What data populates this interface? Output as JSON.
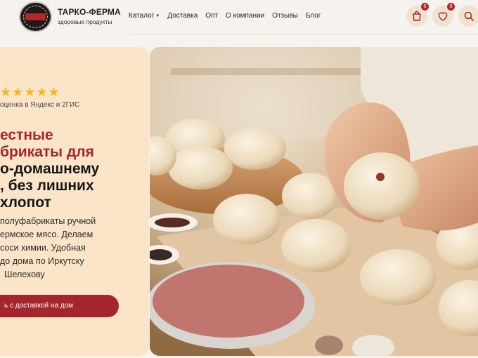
{
  "header": {
    "brand_name": "ТАРКО-ФЕРМА",
    "brand_tagline": "здоровые продукты",
    "logo_text": "ТАРКО ФЕРМА",
    "nav": [
      {
        "label": "Каталог",
        "has_dropdown": true
      },
      {
        "label": "Доставка"
      },
      {
        "label": "Опт"
      },
      {
        "label": "О компании"
      },
      {
        "label": "Отзывы"
      },
      {
        "label": "Блог"
      }
    ],
    "cart_count": "0",
    "favorites_count": "0"
  },
  "hero": {
    "stars": "★★★★★",
    "rating_text": "оценка в Яндекс и 2ГИС",
    "title_red_1": "естные",
    "title_red_2": "брикаты для",
    "title_dark_1": "о-домашнему",
    "title_dark_2": ", без лишних",
    "title_dark_3": "хлопот",
    "desc_1": "полуфабрикаты ручной",
    "desc_2": "ермское мясо. Делаем",
    "desc_3": "соси химии. Удобная",
    "desc_4": "до дома по Иркутску",
    "desc_5": "Шелехову",
    "cta_label": "ь с доставкой на дом"
  },
  "colors": {
    "accent": "#a4262c",
    "card_bg": "#fbe4c8",
    "icon_bg": "#efe2cf",
    "star": "#f2b81f"
  },
  "icons": [
    "bag-icon",
    "heart-icon",
    "search-icon",
    "chevron-down-icon"
  ]
}
